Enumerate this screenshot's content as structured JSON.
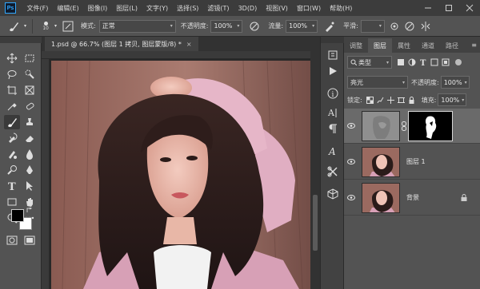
{
  "app": {
    "logo_text": "Ps"
  },
  "menu": {
    "items": [
      "文件(F)",
      "编辑(E)",
      "图像(I)",
      "图层(L)",
      "文字(Y)",
      "选择(S)",
      "滤镜(T)",
      "3D(D)",
      "视图(V)",
      "窗口(W)",
      "帮助(H)"
    ]
  },
  "window_controls": {
    "minimize": "minimize-icon",
    "maximize": "maximize-icon",
    "close": "close-icon"
  },
  "options": {
    "brush_size": "10",
    "mode_label": "模式:",
    "mode_value": "正常",
    "opacity_label": "不透明度:",
    "opacity_value": "100%",
    "flow_label": "流量:",
    "flow_value": "100%",
    "smooth_label": "平滑:"
  },
  "document": {
    "tab_title": "1.psd @ 66.7% (图层 1 拷贝, 图层蒙版/8) *",
    "close_glyph": "×"
  },
  "layers_panel": {
    "tabs": [
      "调整",
      "图层",
      "属性",
      "通道",
      "路径"
    ],
    "active_tab": 1,
    "filter_label": "类型",
    "blend_mode": "亮光",
    "opacity_label": "不透明度:",
    "opacity_value": "100%",
    "lock_label": "锁定:",
    "fill_label": "填充:",
    "fill_value": "100%",
    "layers": [
      {
        "name": "",
        "has_mask": true,
        "selected": true,
        "visible": true
      },
      {
        "name": "图层 1",
        "has_mask": false,
        "selected": false,
        "visible": true
      },
      {
        "name": "背景",
        "has_mask": false,
        "selected": false,
        "visible": true,
        "locked": true
      }
    ]
  },
  "colors": {
    "foreground": "#000000",
    "background": "#ffffff",
    "accent": "#31a8ff"
  }
}
